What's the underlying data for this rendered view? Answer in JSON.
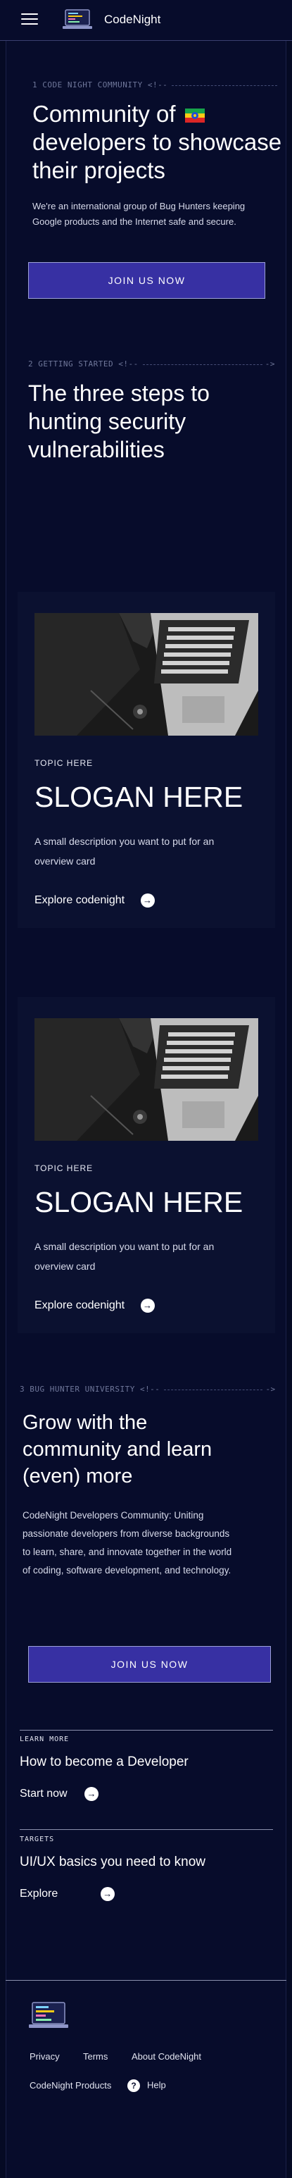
{
  "header": {
    "brand": "CodeNight",
    "menu_icon": "hamburger-icon",
    "logo_icon": "laptop-code-logo"
  },
  "hero": {
    "eyebrow": "1 CODE NIGHT COMMUNITY <!--",
    "title_line1": "Community of",
    "flag_icon": "ethiopia-flag-icon",
    "title_line2": "developers to showcase",
    "title_line3": "their projects",
    "lead_line1": "We're an international group of Bug Hunters keeping",
    "lead_line2": "Google products and the Internet safe and secure.",
    "button": "JOIN US NOW"
  },
  "steps": {
    "eyebrow": "2 GETTING STARTED <!--",
    "end_mark": "->",
    "title_line1": "The three steps to",
    "title_line2": "hunting security",
    "title_line3": "vulnerabilities"
  },
  "cards": [
    {
      "topic": "TOPIC HERE",
      "slogan": "SLOGAN HERE",
      "desc_line1": "A small  description you want to put for an",
      "desc_line2": "overview card",
      "link": "Explore codenight"
    },
    {
      "topic": "TOPIC HERE",
      "slogan": "SLOGAN HERE",
      "desc_line1": "A small  description you want to put for an",
      "desc_line2": "overview card",
      "link": "Explore codenight"
    }
  ],
  "university": {
    "eyebrow": "3 BUG HUNTER UNIVERSITY <!--",
    "end_mark": "->",
    "title_line1": "Grow with the",
    "title_line2": "community and learn",
    "title_line3": "(even) more",
    "lead_line1": "CodeNight Developers Community: Uniting",
    "lead_line2": "passionate developers from diverse backgrounds",
    "lead_line3": "to learn, share, and innovate together in the world",
    "lead_line4": "of coding, software development, and technology.",
    "button": "JOIN US NOW"
  },
  "learn_more": {
    "label": "LEARN MORE",
    "title": "How to become a Developer",
    "link": "Start now"
  },
  "targets": {
    "label": "TARGETS",
    "title": "UI/UX basics you need to know",
    "link": "Explore"
  },
  "footer": {
    "links_row1": [
      "Privacy",
      "Terms",
      "About CodeNight"
    ],
    "links_row2": [
      "CodeNight Products",
      "Help"
    ],
    "help_icon": "question-circle-icon"
  },
  "colors": {
    "background": "#050a24",
    "panel": "#070c2b",
    "accent": "#3730a3"
  }
}
